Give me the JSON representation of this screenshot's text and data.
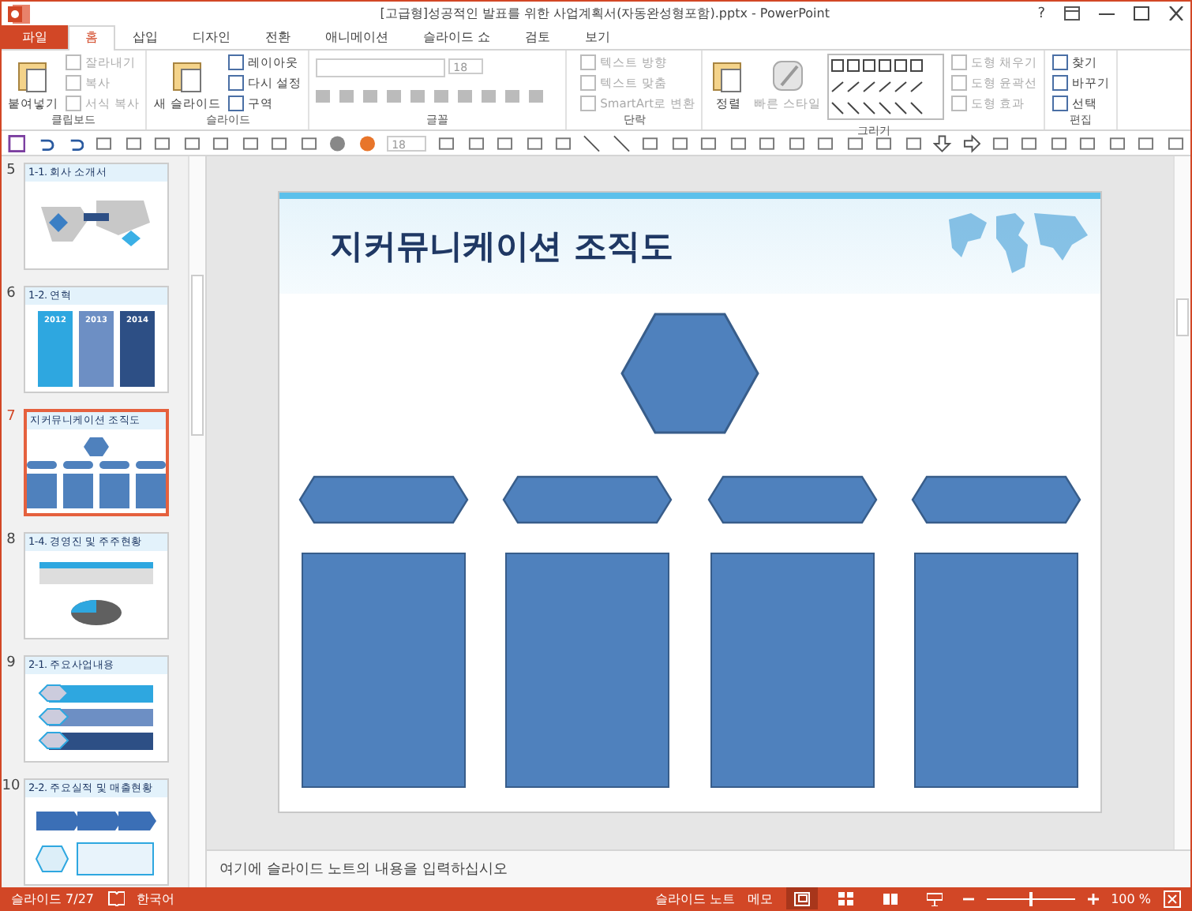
{
  "window": {
    "title": "[고급형]성공적인 발표를 위한 사업계획서(자동완성형포함).pptx - PowerPoint",
    "help": "?"
  },
  "tabs": [
    {
      "label": "파일",
      "kind": "file",
      "selected": false
    },
    {
      "label": "홈",
      "kind": "tab",
      "selected": true
    },
    {
      "label": "삽입",
      "kind": "tab",
      "selected": false
    },
    {
      "label": "디자인",
      "kind": "tab",
      "selected": false
    },
    {
      "label": "전환",
      "kind": "tab",
      "selected": false
    },
    {
      "label": "애니메이션",
      "kind": "tab",
      "selected": false
    },
    {
      "label": "슬라이드 쇼",
      "kind": "tab",
      "selected": false
    },
    {
      "label": "검토",
      "kind": "tab",
      "selected": false
    },
    {
      "label": "보기",
      "kind": "tab",
      "selected": false
    }
  ],
  "ribbon": {
    "groups": [
      {
        "label": "클립보드",
        "big": {
          "label": "붙여넣기",
          "disabled": false
        },
        "items": [
          {
            "label": "잘라내기",
            "disabled": true
          },
          {
            "label": "복사",
            "disabled": true
          },
          {
            "label": "서식 복사",
            "disabled": true
          }
        ]
      },
      {
        "label": "슬라이드",
        "big": {
          "label": "새 슬라이드",
          "disabled": false
        },
        "items": [
          {
            "label": "레이아웃",
            "disabled": false
          },
          {
            "label": "다시 설정",
            "disabled": false
          },
          {
            "label": "구역",
            "disabled": false
          }
        ]
      },
      {
        "label": "글꼴",
        "font_size": "18"
      },
      {
        "label": "단락",
        "items": [
          {
            "label": "텍스트 방향",
            "disabled": true
          },
          {
            "label": "텍스트 맞춤",
            "disabled": true
          },
          {
            "label": "SmartArt로 변환",
            "disabled": true
          }
        ]
      },
      {
        "label": "그리기",
        "big": {
          "label": "정렬",
          "disabled": false
        },
        "big2": {
          "label": "빠른 스타일",
          "disabled": true
        },
        "items": [
          {
            "label": "도형 채우기",
            "disabled": true
          },
          {
            "label": "도형 윤곽선",
            "disabled": true
          },
          {
            "label": "도형 효과",
            "disabled": true
          }
        ]
      },
      {
        "label": "편집",
        "items": [
          {
            "label": "찾기",
            "disabled": false
          },
          {
            "label": "바꾸기",
            "disabled": false
          },
          {
            "label": "선택",
            "disabled": false
          }
        ]
      }
    ]
  },
  "quick_access": {
    "font_size": "18"
  },
  "slides": [
    {
      "number": "5",
      "title": "1-1. 회사 소개서",
      "kind": "map",
      "selected": false
    },
    {
      "number": "6",
      "title": "1-2. 연혁",
      "kind": "timeline",
      "labels": [
        "2012",
        "2013",
        "2014"
      ],
      "selected": false
    },
    {
      "number": "7",
      "title": "지커뮤니케이션 조직도",
      "kind": "org",
      "selected": true
    },
    {
      "number": "8",
      "title": "1-4. 경영진 및 주주현황",
      "kind": "table-pie",
      "selected": false
    },
    {
      "number": "9",
      "title": "2-1. 주요사업내용",
      "kind": "list",
      "selected": false
    },
    {
      "number": "10",
      "title": "2-2. 주요실적 및 매출현황",
      "kind": "process",
      "selected": false
    }
  ],
  "slide": {
    "title": "지커뮤니케이션 조직도"
  },
  "notes": {
    "placeholder": "여기에 슬라이드 노트의 내용을 입력하십시오"
  },
  "status_bar": {
    "slide": "슬라이드 7/27",
    "language": "한국어",
    "notes": "슬라이드 노트",
    "comments": "메모",
    "zoom": "100 %",
    "zoom_slider": {
      "level": 0.5
    },
    "views": [
      {
        "kind": "normal",
        "selected": true
      },
      {
        "kind": "sorter",
        "selected": false
      },
      {
        "kind": "reading",
        "selected": false
      },
      {
        "kind": "show",
        "selected": false
      }
    ]
  }
}
